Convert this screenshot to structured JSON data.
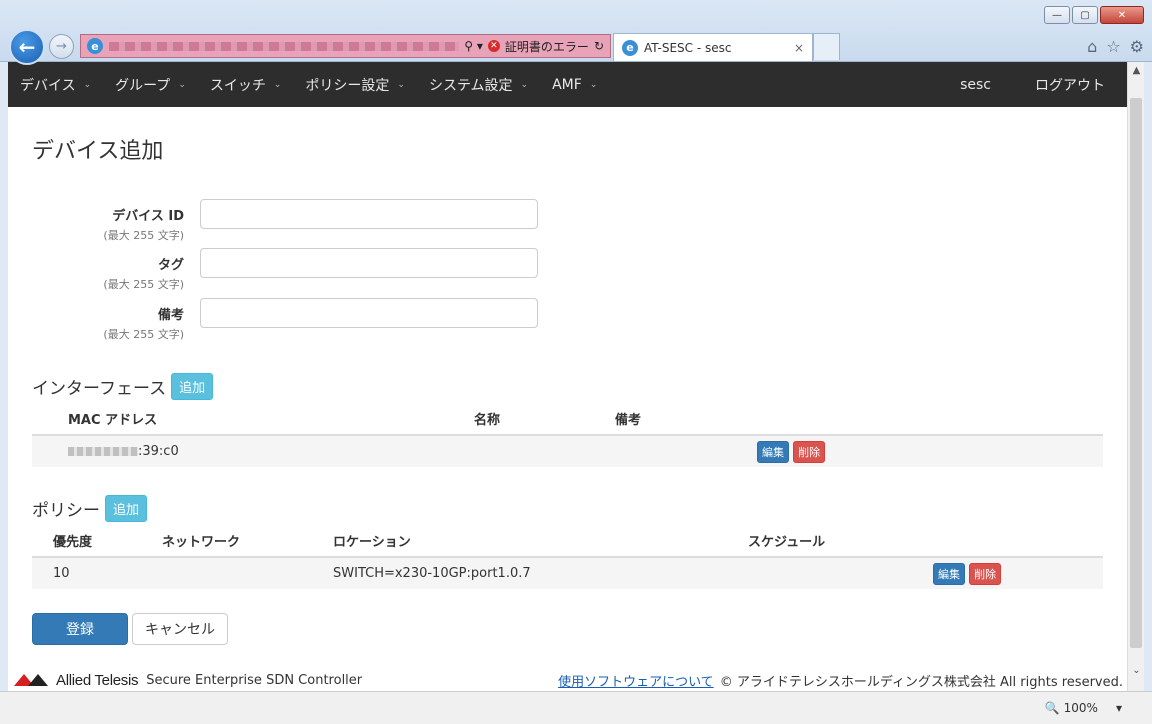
{
  "browser": {
    "address_tools": "⚲ ▾",
    "cert_error": "証明書のエラー",
    "refresh": "↻",
    "tab_title": "AT-SESC - sesc",
    "tab_close": "×",
    "win_min": "—",
    "win_max": "▢",
    "win_close": "✕",
    "icons": {
      "home": "⌂",
      "favorites": "☆",
      "settings": "⚙"
    },
    "zoom": "100%",
    "zoom_caret": "▾"
  },
  "nav": {
    "items": [
      "デバイス",
      "グループ",
      "スイッチ",
      "ポリシー設定",
      "システム設定",
      "AMF"
    ],
    "user": "sesc",
    "logout": "ログアウト"
  },
  "page": {
    "title": "デバイス追加",
    "fields": [
      {
        "label": "デバイス ID",
        "hint": "(最大 255 文字)",
        "value": ""
      },
      {
        "label": "タグ",
        "hint": "(最大 255 文字)",
        "value": ""
      },
      {
        "label": "備考",
        "hint": "(最大 255 文字)",
        "value": ""
      }
    ],
    "interfaces": {
      "heading": "インターフェース",
      "add_label": "追加",
      "columns": [
        "MAC アドレス",
        "名称",
        "備考"
      ],
      "rows": [
        {
          "mac_suffix": ":39:c0",
          "name": "",
          "note": "",
          "edit": "編集",
          "delete": "削除"
        }
      ]
    },
    "policies": {
      "heading": "ポリシー",
      "add_label": "追加",
      "columns": [
        "優先度",
        "ネットワーク",
        "ロケーション",
        "スケジュール"
      ],
      "rows": [
        {
          "priority": "10",
          "network": "",
          "location": "SWITCH=x230-10GP:port1.0.7",
          "schedule": "",
          "edit": "編集",
          "delete": "削除"
        }
      ]
    },
    "submit_label": "登録",
    "cancel_label": "キャンセル"
  },
  "footer": {
    "company_logo_text": "Allied Telesis",
    "product": "Secure Enterprise SDN Controller",
    "software_link": "使用ソフトウェアについて",
    "copyright": "© アライドテレシスホールディングス株式会社 All rights reserved."
  }
}
